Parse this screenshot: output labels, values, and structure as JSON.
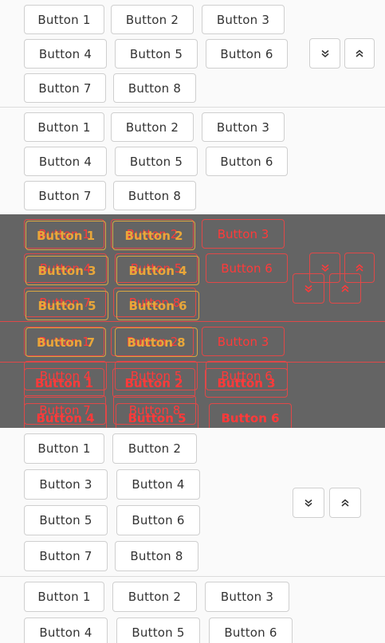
{
  "group1": {
    "buttons": [
      "Button 1",
      "Button 2",
      "Button 3",
      "Button 4",
      "Button 5",
      "Button 6",
      "Button 7",
      "Button 8"
    ],
    "expand_icon": "chevron-double-down-icon",
    "collapse_icon": "chevron-double-up-icon"
  },
  "group2": {
    "buttons": [
      "Button 1",
      "Button 2",
      "Button 3",
      "Button 4",
      "Button 5",
      "Button 6",
      "Button 7",
      "Button 8"
    ]
  },
  "overlay": {
    "color": "#646464",
    "ghost_color": "#e04848",
    "labels": [
      "Button 1",
      "Button 2",
      "Button 3",
      "Button 4",
      "Button 5",
      "Button 6",
      "Button 7",
      "Button 8"
    ]
  },
  "group3": {
    "buttons": [
      "Button 1",
      "Button 2",
      "Button 3",
      "Button 4",
      "Button 5",
      "Button 6",
      "Button 7",
      "Button 8"
    ],
    "expand_icon": "chevron-double-down-icon",
    "collapse_icon": "chevron-double-up-icon"
  },
  "group4": {
    "buttons": [
      "Button 1",
      "Button 2",
      "Button 3",
      "Button 4",
      "Button 5",
      "Button 6"
    ]
  }
}
